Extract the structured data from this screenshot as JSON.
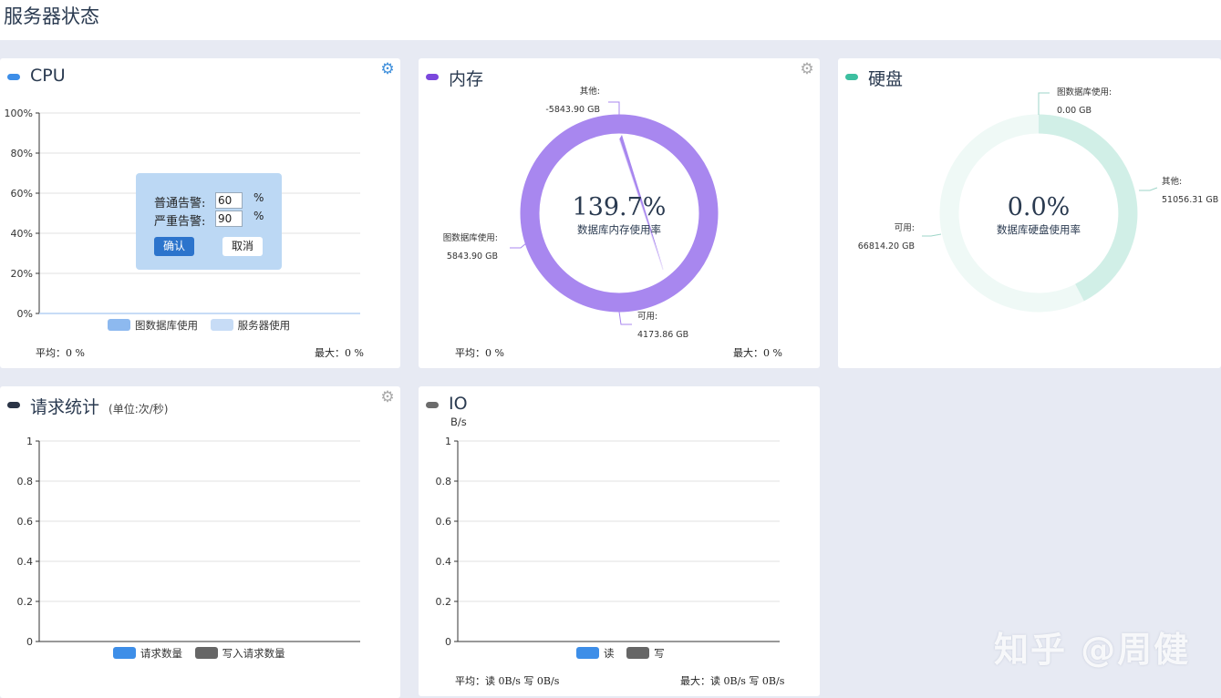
{
  "page": {
    "title": "服务器状态"
  },
  "colors": {
    "cpu": "#3d8ee8",
    "memory": "#7b48dd",
    "disk": "#3dbfa0",
    "requests": "#2a3446",
    "io": "#6c6c6c",
    "accent": "#2c74cc"
  },
  "cpu_card": {
    "title": "CPU",
    "gear_icon": "gear-icon",
    "avg_label": "平均：0 %",
    "max_label": "最大：0 %",
    "legend": [
      "图数据库使用",
      "服务器使用"
    ],
    "popover": {
      "normal_label": "普通告警:",
      "normal_value": "60",
      "critical_label": "严重告警:",
      "critical_value": "90",
      "unit": "%",
      "confirm_label": "确认",
      "cancel_label": "取消"
    }
  },
  "memory_card": {
    "title": "内存",
    "percent": "139.7%",
    "center_label": "数据库内存使用率",
    "avg_label": "平均：0 %",
    "max_label": "最大：0 %",
    "callouts": {
      "other_name": "其他:",
      "other_value": "-5843.90 GB",
      "graphdb_name": "图数据库使用:",
      "graphdb_value": "5843.90 GB",
      "available_name": "可用:",
      "available_value": "4173.86 GB"
    }
  },
  "disk_card": {
    "title": "硬盘",
    "percent": "0.0%",
    "center_label": "数据库硬盘使用率",
    "callouts": {
      "graphdb_name": "图数据库使用:",
      "graphdb_value": "0.00 GB",
      "other_name": "其他:",
      "other_value": "51056.31 GB",
      "available_name": "可用:",
      "available_value": "66814.20 GB"
    }
  },
  "requests_card": {
    "title": "请求统计",
    "subtitle": "(单位:次/秒)",
    "legend": [
      "请求数量",
      "写入请求数量"
    ]
  },
  "io_card": {
    "title": "IO",
    "unit": "B/s",
    "legend": [
      "读",
      "写"
    ],
    "avg_label": "平均：读 0B/s 写 0B/s",
    "max_label": "最大：读 0B/s 写 0B/s"
  },
  "watermark": "知乎 @周健",
  "chart_data": [
    {
      "type": "line",
      "name": "cpu",
      "ylim": [
        0,
        100
      ],
      "yticks": [
        "0%",
        "20%",
        "40%",
        "60%",
        "80%",
        "100%"
      ],
      "series": [
        {
          "name": "图数据库使用",
          "values": [
            0
          ]
        },
        {
          "name": "服务器使用",
          "values": [
            0
          ]
        }
      ],
      "grid": true,
      "legend": "bottom"
    },
    {
      "type": "pie",
      "name": "memory",
      "labels": [
        "图数据库使用",
        "可用",
        "其他"
      ],
      "values": [
        5843.9,
        4173.86,
        -5843.9
      ],
      "unit": "GB",
      "center_text": "139.7%"
    },
    {
      "type": "pie",
      "name": "disk",
      "labels": [
        "图数据库使用",
        "其他",
        "可用"
      ],
      "values": [
        0.0,
        51056.31,
        66814.2
      ],
      "unit": "GB",
      "center_text": "0.0%"
    },
    {
      "type": "line",
      "name": "requests",
      "ylim": [
        0,
        1
      ],
      "yticks": [
        "0",
        "0.2",
        "0.4",
        "0.6",
        "0.8",
        "1"
      ],
      "series": [
        {
          "name": "请求数量",
          "values": []
        },
        {
          "name": "写入请求数量",
          "values": []
        }
      ],
      "grid": true,
      "legend": "bottom"
    },
    {
      "type": "line",
      "name": "io",
      "ylim": [
        0,
        1
      ],
      "ylabel": "B/s",
      "yticks": [
        "0",
        "0.2",
        "0.4",
        "0.6",
        "0.8",
        "1"
      ],
      "series": [
        {
          "name": "读",
          "values": []
        },
        {
          "name": "写",
          "values": []
        }
      ],
      "grid": true,
      "legend": "bottom"
    }
  ]
}
